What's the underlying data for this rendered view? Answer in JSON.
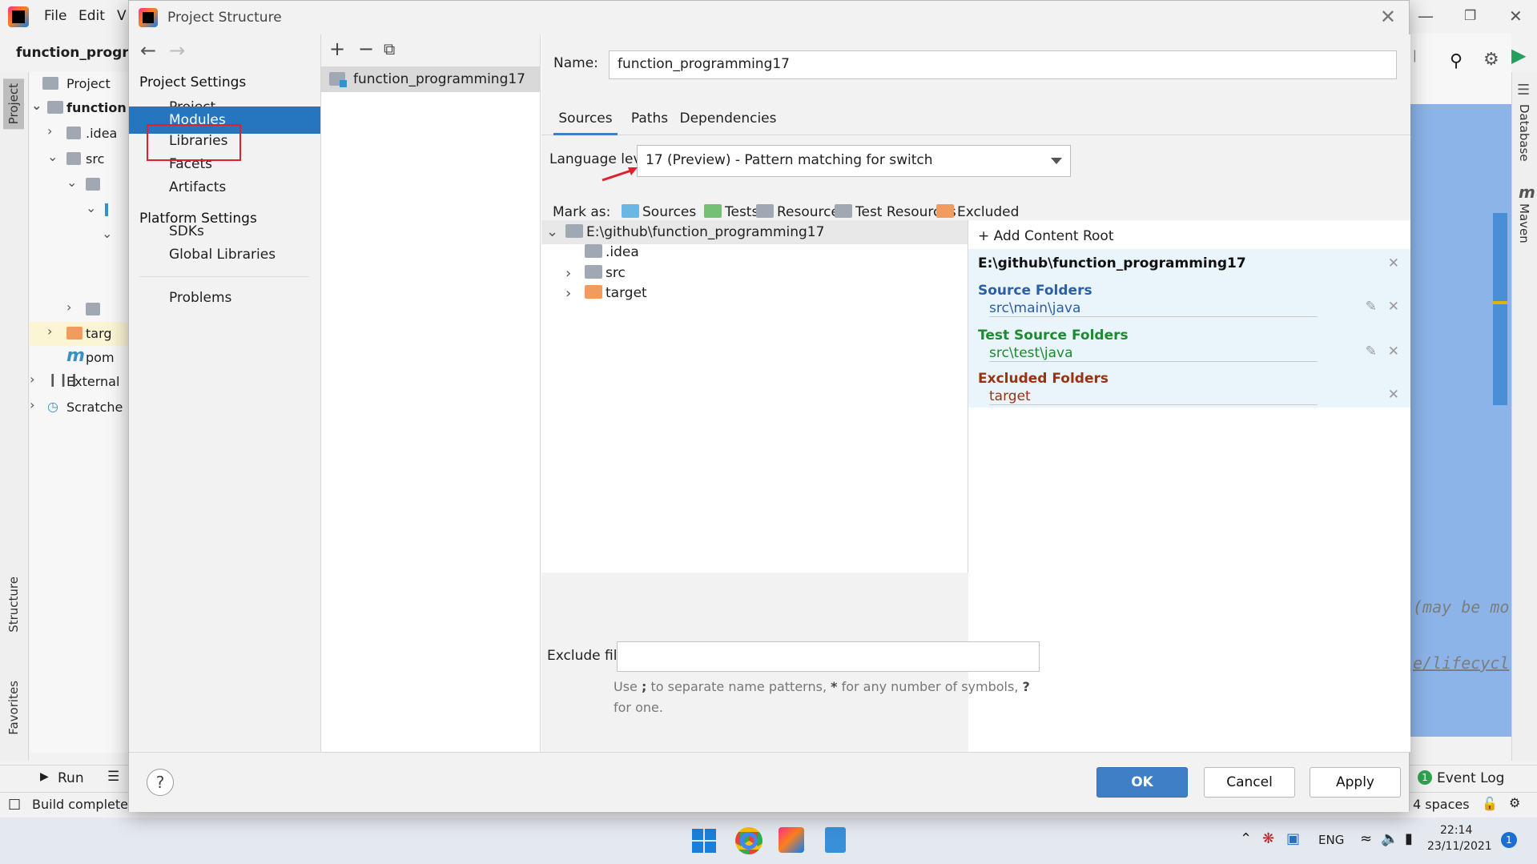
{
  "ide": {
    "menu": [
      "File",
      "Edit",
      "V"
    ],
    "project_title": "function_program",
    "tree": [
      {
        "label": "Project",
        "type": "dropdown"
      },
      {
        "label": "function",
        "type": "root"
      },
      {
        "label": ".idea",
        "type": "folder"
      },
      {
        "label": "src",
        "type": "folder"
      },
      {
        "label": "targ",
        "type": "folder-orange"
      },
      {
        "label": "pom",
        "type": "maven"
      },
      {
        "label": "External",
        "type": "lib"
      },
      {
        "label": "Scratche",
        "type": "scratch"
      }
    ],
    "left_tabs": {
      "project": "Project",
      "structure": "Structure",
      "favorites": "Favorites"
    },
    "right_tabs": {
      "database": "Database",
      "maven": "Maven"
    },
    "warning_count": "1",
    "code_hint_1": "(may be mo",
    "code_hint_2": "e/lifecycl",
    "bottom_tabs": {
      "run": "Run",
      "event_log": "Event Log",
      "event_count": "1"
    },
    "status": {
      "left": "Build completed",
      "indent": "4 spaces"
    }
  },
  "taskbar": {
    "lang": "ENG",
    "time": "22:14",
    "date": "23/11/2021",
    "notifications": "1"
  },
  "dialog": {
    "title": "Project Structure",
    "nav": {
      "project_settings": "Project Settings",
      "project_items": [
        "Project",
        "Modules",
        "Libraries",
        "Facets",
        "Artifacts"
      ],
      "platform_settings": "Platform Settings",
      "platform_items": [
        "SDKs",
        "Global Libraries"
      ],
      "problems": "Problems"
    },
    "module_name": "function_programming17",
    "name_label": "Name:",
    "name_value": "function_programming17",
    "tabs": [
      "Sources",
      "Paths",
      "Dependencies"
    ],
    "language_level_label": "Language level:",
    "language_level_value": "17 (Preview) - Pattern matching for switch",
    "mark_as_label": "Mark as:",
    "mark_as": [
      {
        "label": "Sources",
        "color": "#6cb6e3"
      },
      {
        "label": "Tests",
        "color": "#75c075"
      },
      {
        "label": "Resources",
        "color": "#9fa8b3"
      },
      {
        "label": "Test Resources",
        "color": "#9fa8b3"
      },
      {
        "label": "Excluded",
        "color": "#f19b5e"
      }
    ],
    "content_root": "E:\\github\\function_programming17",
    "content_children": [
      ".idea",
      "src",
      "target"
    ],
    "add_content_root": "Add Content Root",
    "roots": {
      "path": "E:\\github\\function_programming17",
      "source_folders_title": "Source Folders",
      "source_folder": "src\\main\\java",
      "test_source_folders_title": "Test Source Folders",
      "test_source_folder": "src\\test\\java",
      "excluded_folders_title": "Excluded Folders",
      "excluded_folder": "target",
      "source_color": "#2a5fa8",
      "test_color": "#1d8a32",
      "excluded_color": "#9a3312"
    },
    "exclude_files_label": "Exclude files:",
    "exclude_hint_pre": "Use ",
    "exclude_hint_semicolon": ";",
    "exclude_hint_mid1": " to separate name patterns, ",
    "exclude_hint_star": "*",
    "exclude_hint_mid2": " for any number of symbols, ",
    "exclude_hint_q": "?",
    "exclude_hint_end": " for one.",
    "buttons": {
      "ok": "OK",
      "cancel": "Cancel",
      "apply": "Apply",
      "help": "?"
    }
  }
}
